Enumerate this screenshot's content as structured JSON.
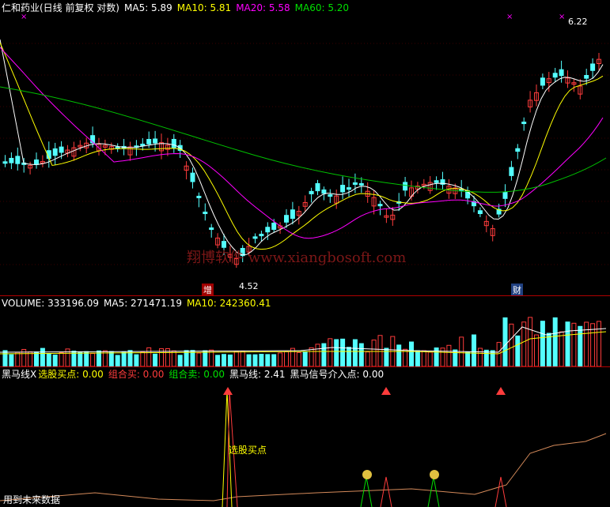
{
  "price_header": {
    "title": "仁和药业(日线 前复权 对数)",
    "ma5": "MA5: 5.89",
    "ma10": "MA10: 5.81",
    "ma20": "MA20: 5.58",
    "ma60": "MA60: 5.20"
  },
  "price_annotations": {
    "high": "6.22",
    "low": "4.52",
    "tag_left": "增",
    "tag_right": "财"
  },
  "watermark": "翔博软件 www.xiangbosoft.com",
  "volume_header": {
    "volume": "VOLUME: 333196.09",
    "ma5": "MA5: 271471.19",
    "ma10": "MA10: 242360.41"
  },
  "indicator_header": {
    "name": "黑马线X",
    "pick_buy": "选股买点: 0.00",
    "combo_buy": "组合买: 0.00",
    "combo_sell": "组合卖: 0.00",
    "black_horse": "黑马线: 2.41",
    "signal": "黑马信号介入点: 0.00"
  },
  "indicator_annotations": {
    "pick_label": "选股买点",
    "footer": "用到未来数据"
  },
  "colors": {
    "up": "#ff3c3c",
    "down": "#54ffff",
    "ma5": "#ffffff",
    "ma10": "#ffff00",
    "ma20": "#ff00ff",
    "ma60": "#00c000",
    "divider": "#b00000"
  },
  "chart_data": {
    "type": "candlestick",
    "price_scale": "log",
    "price_extremes": {
      "high": 6.22,
      "low": 4.52
    }
  }
}
